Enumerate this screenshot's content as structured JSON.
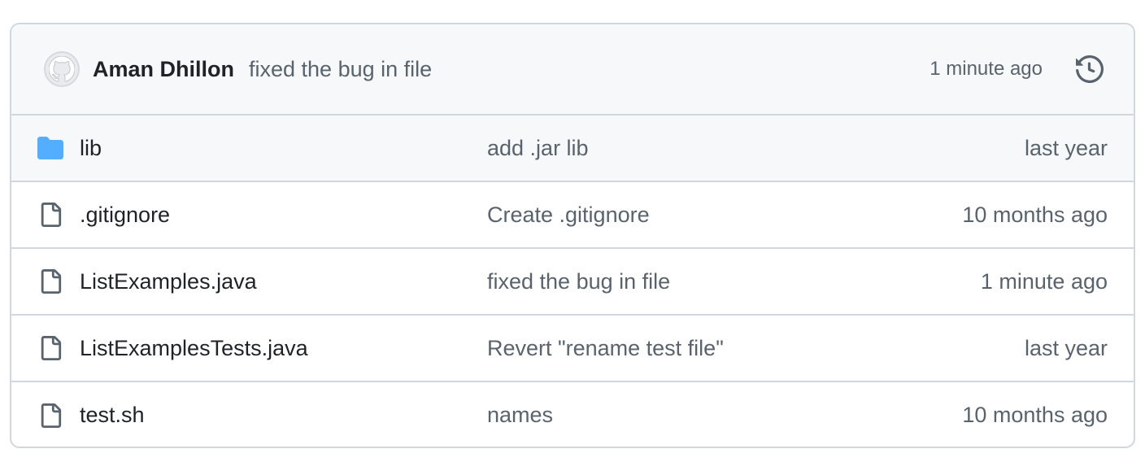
{
  "latest_commit": {
    "author": "Aman Dhillon",
    "message": "fixed the bug in file",
    "time": "1 minute ago",
    "avatar_icon": "github-octocat-icon",
    "history_icon": "history-icon"
  },
  "files": [
    {
      "type": "folder",
      "icon": "folder-icon",
      "name": "lib",
      "message": "add .jar lib",
      "time": "last year"
    },
    {
      "type": "file",
      "icon": "file-icon",
      "name": ".gitignore",
      "message": "Create .gitignore",
      "time": "10 months ago"
    },
    {
      "type": "file",
      "icon": "file-icon",
      "name": "ListExamples.java",
      "message": "fixed the bug in file",
      "time": "1 minute ago"
    },
    {
      "type": "file",
      "icon": "file-icon",
      "name": "ListExamplesTests.java",
      "message": "Revert \"rename test file\"",
      "time": "last year"
    },
    {
      "type": "file",
      "icon": "file-icon",
      "name": "test.sh",
      "message": "names",
      "time": "10 months ago"
    }
  ],
  "colors": {
    "folder": "#54aeff",
    "file_icon": "#59636e",
    "border": "#d0d7de",
    "header_bg": "#f6f8fa"
  }
}
